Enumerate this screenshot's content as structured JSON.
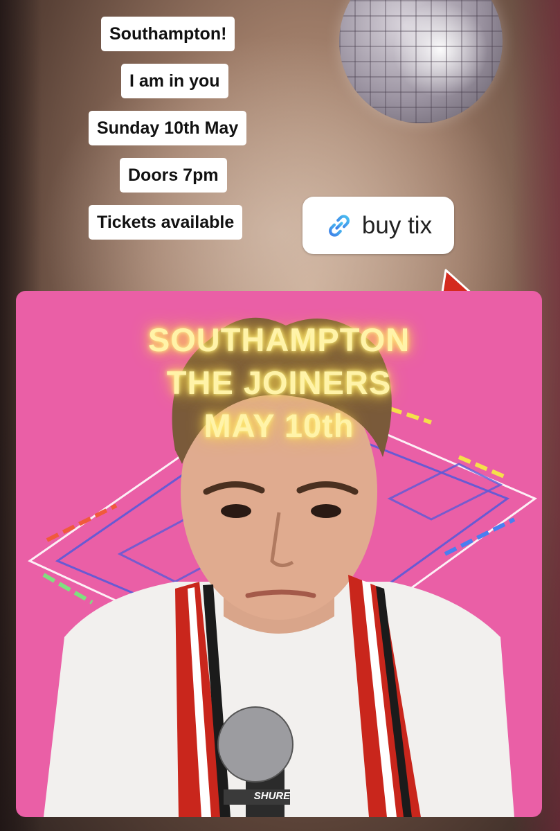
{
  "stickers": [
    "Southampton!",
    "I am in you",
    "Sunday 10th May",
    "Doors 7pm",
    "Tickets available"
  ],
  "link_sticker": {
    "label": "buy tix",
    "icon": "link-icon"
  },
  "poster": {
    "headline": [
      "SOUTHAMPTON",
      "THE JOINERS",
      "MAY 10th"
    ],
    "mic_brand": "SHURE",
    "background_color": "#ea5fa6",
    "headline_color": "#fff3a8"
  },
  "decorations": {
    "disco_ball": "disco-ball-icon",
    "arrow": "red-up-arrow-icon",
    "arrow_color": "#d42a1e"
  }
}
